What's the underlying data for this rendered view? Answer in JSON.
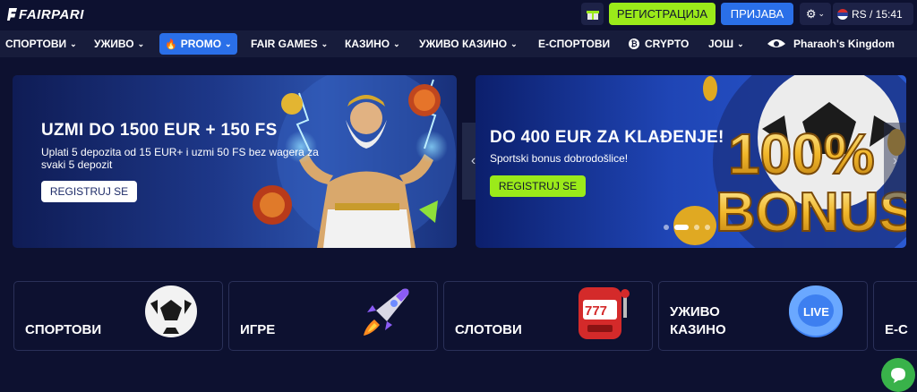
{
  "header": {
    "logo_text": "FAIRPARI",
    "register_label": "РЕГИСТРАЦИЈА",
    "login_label": "ПРИЈАВА",
    "locale_label": "RS / 15:41"
  },
  "nav": {
    "items": [
      {
        "label": "СПОРТОВИ",
        "chevron": true
      },
      {
        "label": "УЖИВО",
        "chevron": true
      },
      {
        "label": "PROMO",
        "chevron": true,
        "active": true
      },
      {
        "label": "FAIR GAMES",
        "chevron": true
      },
      {
        "label": "КАЗИНО",
        "chevron": true
      },
      {
        "label": "УЖИВО КАЗИНО",
        "chevron": true
      },
      {
        "label": "Е-СПОРТОВИ",
        "chevron": false
      },
      {
        "label": "CRYPTO",
        "chevron": false
      },
      {
        "label": "ЈОШ",
        "chevron": true
      },
      {
        "label": "Pharaoh's Kingdom",
        "chevron": false
      }
    ]
  },
  "slider": {
    "banner1": {
      "title": "UZMI DO 1500 EUR + 150 FS",
      "subtitle": "Uplati 5 depozita od 15 EUR+ i uzmi 50 FS bez wagera za svaki 5 depozit",
      "button": "REGISTRUJ SE"
    },
    "banner2": {
      "title": "DO 400 EUR ZA KLAĐENJE!",
      "subtitle": "Sportski bonus dobrodošlice!",
      "button": "REGISTRUJ SE",
      "art_text_1": "100%",
      "art_text_2": "BONUS"
    },
    "prev_arrow": "‹",
    "next_arrow": "›"
  },
  "categories": [
    {
      "label": "СПОРТОВИ"
    },
    {
      "label": "ИГРЕ"
    },
    {
      "label": "СЛОТОВИ"
    },
    {
      "label": "УЖИВО КАЗИНО"
    },
    {
      "label": "Е-С"
    }
  ],
  "slot_reel": "777",
  "chip_text": "LIVE",
  "colors": {
    "background": "#0d1130",
    "nav": "#171c3b",
    "accent_green": "#9bea1a",
    "accent_blue": "#2a6fe8"
  }
}
